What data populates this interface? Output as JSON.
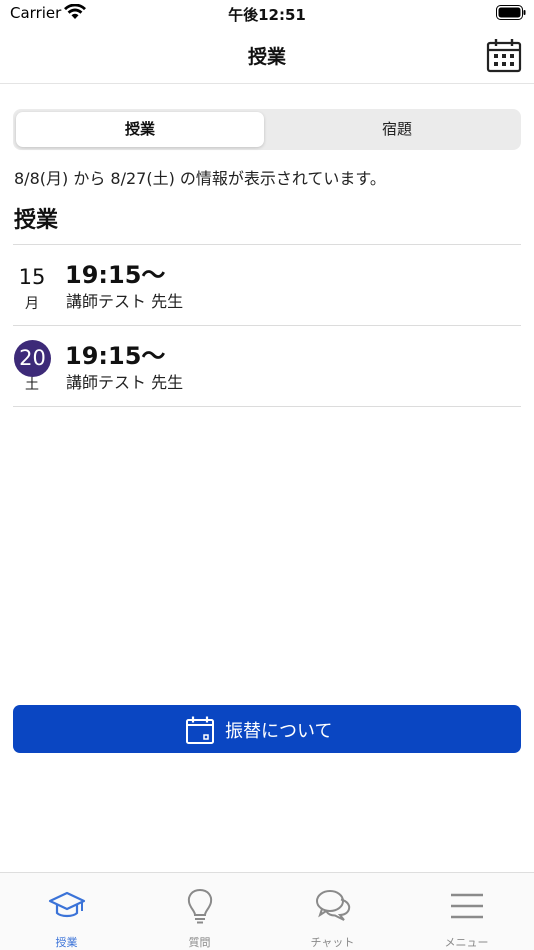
{
  "status_bar": {
    "carrier": "Carrier",
    "time": "午後12:51"
  },
  "nav": {
    "title": "授業",
    "right_icon": "calendar-icon"
  },
  "segments": {
    "items": [
      {
        "label": "授業",
        "active": true
      },
      {
        "label": "宿題",
        "active": false
      }
    ]
  },
  "range_info": "8/8(月) から 8/27(土) の情報が表示されています。",
  "section_heading": "授業",
  "lessons": [
    {
      "day": "15",
      "weekday": "月",
      "time": "19:15～",
      "teacher": "講師テスト 先生",
      "highlighted": false
    },
    {
      "day": "20",
      "weekday": "土",
      "time": "19:15～",
      "teacher": "講師テスト 先生",
      "highlighted": true
    }
  ],
  "transfer_button": {
    "label": "振替について",
    "icon": "calendar-icon"
  },
  "tab_bar": {
    "items": [
      {
        "label": "授業",
        "icon": "graduation-cap-icon",
        "active": true
      },
      {
        "label": "質問",
        "icon": "lightbulb-icon",
        "active": false
      },
      {
        "label": "チャット",
        "icon": "chat-bubbles-icon",
        "active": false
      },
      {
        "label": "メニュー",
        "icon": "hamburger-menu-icon",
        "active": false
      }
    ]
  },
  "colors": {
    "accent": "#0a46c2",
    "today_circle": "#3d2a78",
    "tab_active": "#3b73d8",
    "tab_inactive": "#8a8a8a"
  }
}
